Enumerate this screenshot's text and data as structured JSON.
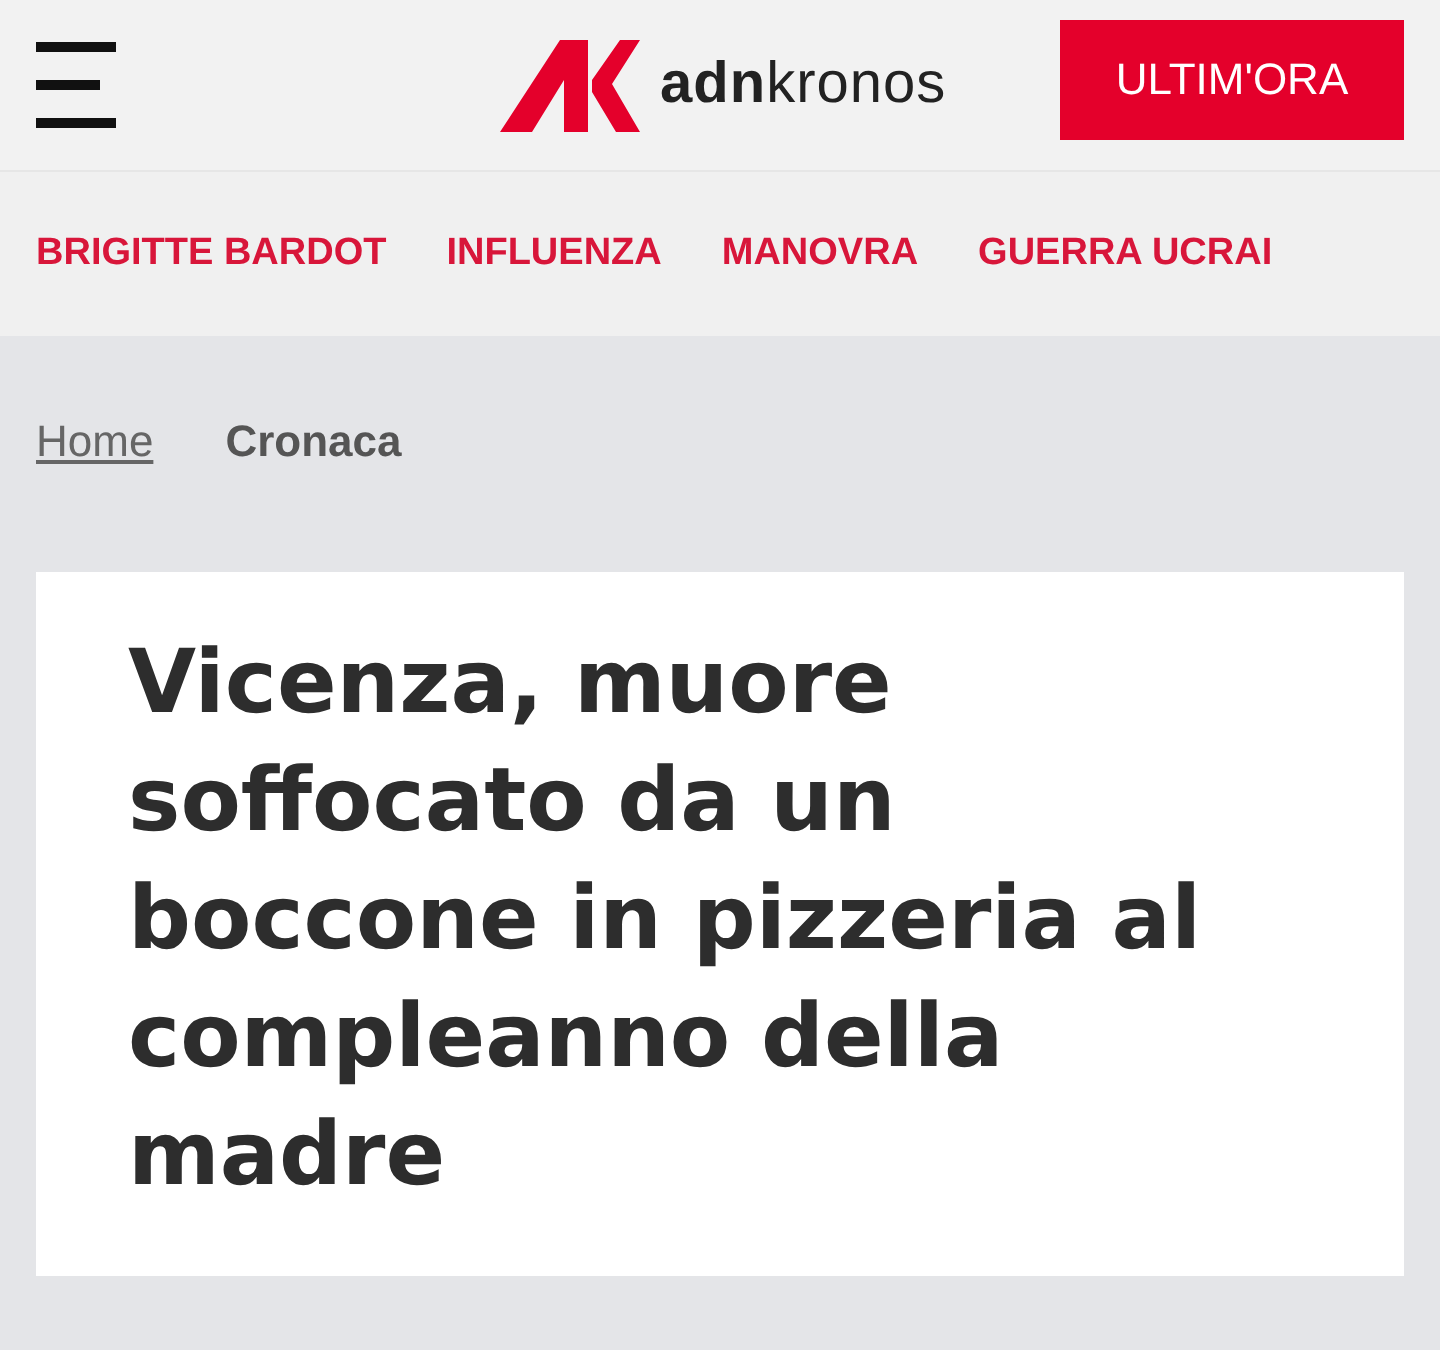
{
  "header": {
    "logo": "**adn**kronos",
    "button": "ULTIM'ORA"
  },
  "nav": [
    "BRIGITTE BARDOT",
    "INFLUENZA",
    "MANOVRA",
    "GUERRA UCRAI"
  ],
  "breadcrumb": [
    {
      "label": "Home",
      "kind": "link"
    },
    {
      "label": "Cronaca",
      "kind": "current"
    }
  ],
  "article": {
    "title": "Vicenza, muore soffocato da un boccone in pizzeria al compleanno della madre"
  }
}
